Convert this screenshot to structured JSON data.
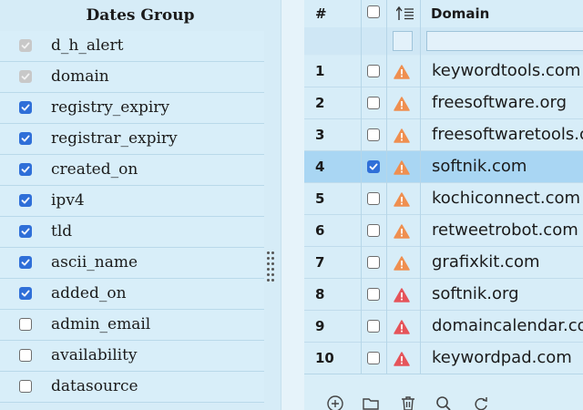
{
  "left_panel": {
    "title": "Dates Group",
    "columns": [
      {
        "label": "d_h_alert",
        "state": "disabled"
      },
      {
        "label": "domain",
        "state": "disabled"
      },
      {
        "label": "registry_expiry",
        "state": "checked"
      },
      {
        "label": "registrar_expiry",
        "state": "checked"
      },
      {
        "label": "created_on",
        "state": "checked"
      },
      {
        "label": "ipv4",
        "state": "checked"
      },
      {
        "label": "tld",
        "state": "checked"
      },
      {
        "label": "ascii_name",
        "state": "checked"
      },
      {
        "label": "added_on",
        "state": "checked"
      },
      {
        "label": "admin_email",
        "state": "unchecked"
      },
      {
        "label": "availability",
        "state": "unchecked"
      },
      {
        "label": "datasource",
        "state": "unchecked"
      }
    ]
  },
  "grid": {
    "header": {
      "num": "#",
      "domain": "Domain"
    },
    "rows": [
      {
        "num": "1",
        "checked": false,
        "alert": "orange",
        "domain": "keywordtools.com"
      },
      {
        "num": "2",
        "checked": false,
        "alert": "orange",
        "domain": "freesoftware.org"
      },
      {
        "num": "3",
        "checked": false,
        "alert": "orange",
        "domain": "freesoftwaretools.com"
      },
      {
        "num": "4",
        "checked": true,
        "alert": "orange",
        "domain": "softnik.com",
        "selected": true
      },
      {
        "num": "5",
        "checked": false,
        "alert": "orange",
        "domain": "kochiconnect.com"
      },
      {
        "num": "6",
        "checked": false,
        "alert": "orange",
        "domain": "retweetrobot.com"
      },
      {
        "num": "7",
        "checked": false,
        "alert": "orange",
        "domain": "grafixkit.com"
      },
      {
        "num": "8",
        "checked": false,
        "alert": "red",
        "domain": "softnik.org"
      },
      {
        "num": "9",
        "checked": false,
        "alert": "red",
        "domain": "domaincalendar.com"
      },
      {
        "num": "10",
        "checked": false,
        "alert": "red",
        "domain": "keywordpad.com"
      }
    ],
    "footer_icons": [
      "add-circle-icon",
      "folder-icon",
      "trash-icon",
      "search-icon",
      "refresh-icon"
    ]
  },
  "colors": {
    "checkbox_blue": "#2f6fd8",
    "alert_orange": "#ef8f50",
    "alert_red": "#e5545a",
    "selected_row": "#a9d6f3"
  }
}
